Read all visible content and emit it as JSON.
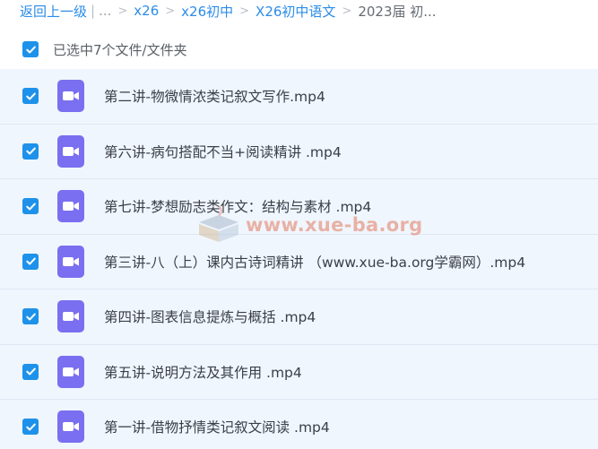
{
  "breadcrumb": {
    "back": "返回上一级",
    "separator_bar": "|",
    "ellipsis": "...",
    "items": [
      "x26",
      "x26初中",
      "X26初中语文"
    ],
    "current": "2023届 初..."
  },
  "selection": {
    "checked": true,
    "text": "已选中7个文件/文件夹"
  },
  "files": [
    {
      "name": "第二讲-物微情浓类记叙文写作.mp4",
      "checked": true,
      "icon": "video-file-icon"
    },
    {
      "name": "第六讲-病句搭配不当+阅读精讲 .mp4",
      "checked": true,
      "icon": "video-file-icon"
    },
    {
      "name": "第七讲-梦想励志类作文：结构与素材 .mp4",
      "checked": true,
      "icon": "video-file-icon"
    },
    {
      "name": "第三讲-八（上）课内古诗词精讲 （www.xue-ba.org学霸网）.mp4",
      "checked": true,
      "icon": "video-file-icon"
    },
    {
      "name": "第四讲-图表信息提炼与概括 .mp4",
      "checked": true,
      "icon": "video-file-icon"
    },
    {
      "name": "第五讲-说明方法及其作用 .mp4",
      "checked": true,
      "icon": "video-file-icon"
    },
    {
      "name": "第一讲-借物抒情类记叙文阅读 .mp4",
      "checked": true,
      "icon": "video-file-icon"
    }
  ],
  "watermark": {
    "text": "www.xue-ba.org"
  },
  "colors": {
    "link": "#2b8ce8",
    "checkbox": "#1e92ea",
    "row_bg": "#f0f6fd",
    "video_icon": "#7a6ff0"
  }
}
